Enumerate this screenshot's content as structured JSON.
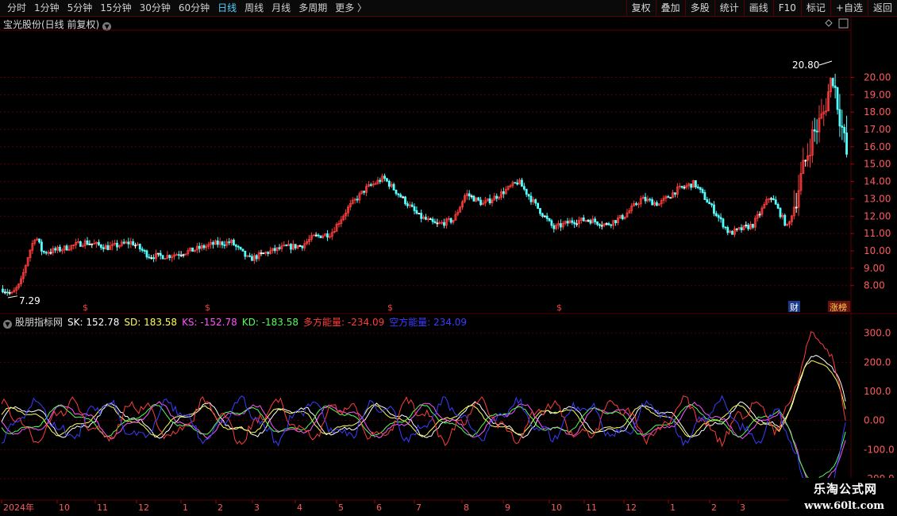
{
  "toolbar": {
    "periods": [
      "分时",
      "1分钟",
      "5分钟",
      "15分钟",
      "30分钟",
      "60分钟",
      "日线",
      "周线",
      "月线",
      "多周期",
      "更多 〉"
    ],
    "active_period": "日线",
    "buttons": [
      "复权",
      "叠加",
      "多股",
      "统计",
      "画线",
      "F10",
      "标记",
      "+自选",
      "返回"
    ]
  },
  "main": {
    "title": "宝光股份(日线 前复权)",
    "high_label": "20.80",
    "low_label": "7.29",
    "y_ticks": [
      "20.00",
      "19.00",
      "18.00",
      "17.00",
      "16.00",
      "15.00",
      "14.00",
      "13.00",
      "12.00",
      "11.00",
      "10.00",
      "9.00",
      "8.00"
    ],
    "s_marker": "$",
    "badge_cai": "财",
    "badge_zhangting": "涨榜",
    "colors": {
      "up": "#ff3c3c",
      "down": "#54ffff",
      "flat": "#ffffff",
      "grid": "#5a0000"
    }
  },
  "indicator": {
    "name": "股朋指标网",
    "values": [
      {
        "label": "SK: 152.78",
        "color": "#ffffff"
      },
      {
        "label": "SD: 183.58",
        "color": "#ffff55"
      },
      {
        "label": "KS: -152.78",
        "color": "#ff55ff"
      },
      {
        "label": "KD: -183.58",
        "color": "#55ff55"
      },
      {
        "label": "多方能量: -234.09",
        "color": "#ff3c3c"
      },
      {
        "label": "空方能量: 234.09",
        "color": "#3c3cff"
      }
    ],
    "y_ticks": [
      "300.0",
      "200.0",
      "100.0",
      "0.00",
      "-100.0",
      "-200.0"
    ]
  },
  "xaxis": {
    "labels": [
      "2024年",
      "10",
      "11",
      "12",
      "1",
      "2",
      "3",
      "4",
      "5",
      "6",
      "7",
      "8",
      "9",
      "10",
      "11",
      "12",
      "1",
      "2",
      "3"
    ]
  },
  "watermark": {
    "line1": "乐淘公式网",
    "line2": "www.60lt.com"
  }
}
